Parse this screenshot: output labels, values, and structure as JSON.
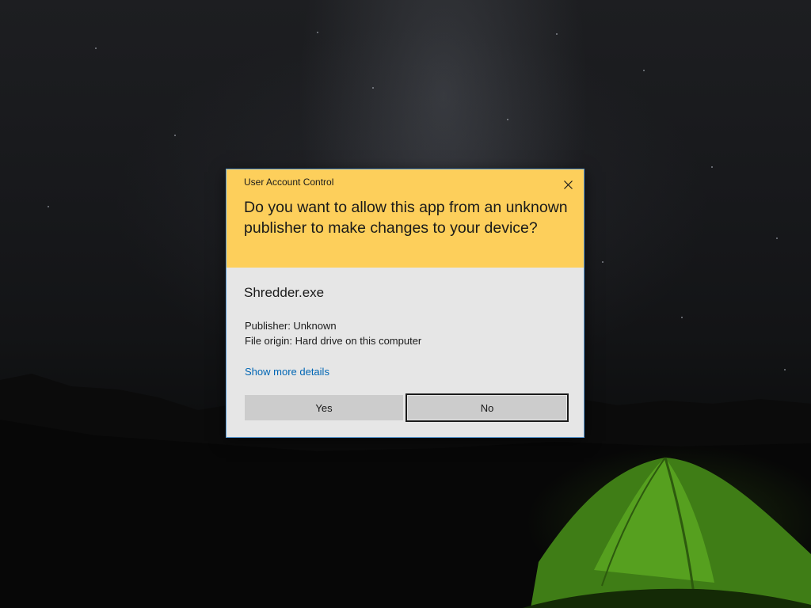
{
  "dialog": {
    "title": "User Account Control",
    "question": "Do you want to allow this app from an unknown publisher to make changes to your device?",
    "app_name": "Shredder.exe",
    "publisher": "Publisher: Unknown",
    "file_origin": "File origin: Hard drive on this computer",
    "details_link": "Show more details",
    "buttons": {
      "yes": "Yes",
      "no": "No"
    },
    "close_icon": "close-icon"
  },
  "colors": {
    "header_bg": "#fdcf5b",
    "body_bg": "#e6e6e6",
    "link": "#0066b4",
    "dialog_border": "#5a9bd6",
    "button_bg": "#cccccc"
  }
}
